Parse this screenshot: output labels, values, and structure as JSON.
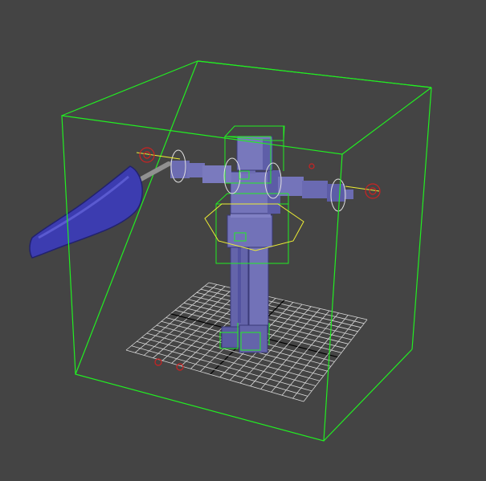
{
  "viewport": {
    "background": "#444444",
    "active_bounds_color": "#22ee22",
    "helper_color": "#e0e0e0",
    "selection_color": "#eeee33",
    "dummy_color": "#cc2222",
    "mesh_color": "#6a6ab0",
    "shield_color": "#3c3cb0",
    "grid_color": "#d8d8d8"
  },
  "scene": {
    "objects": [
      "character-rig",
      "ground-grid",
      "bounding-box",
      "shield-weapon"
    ]
  }
}
